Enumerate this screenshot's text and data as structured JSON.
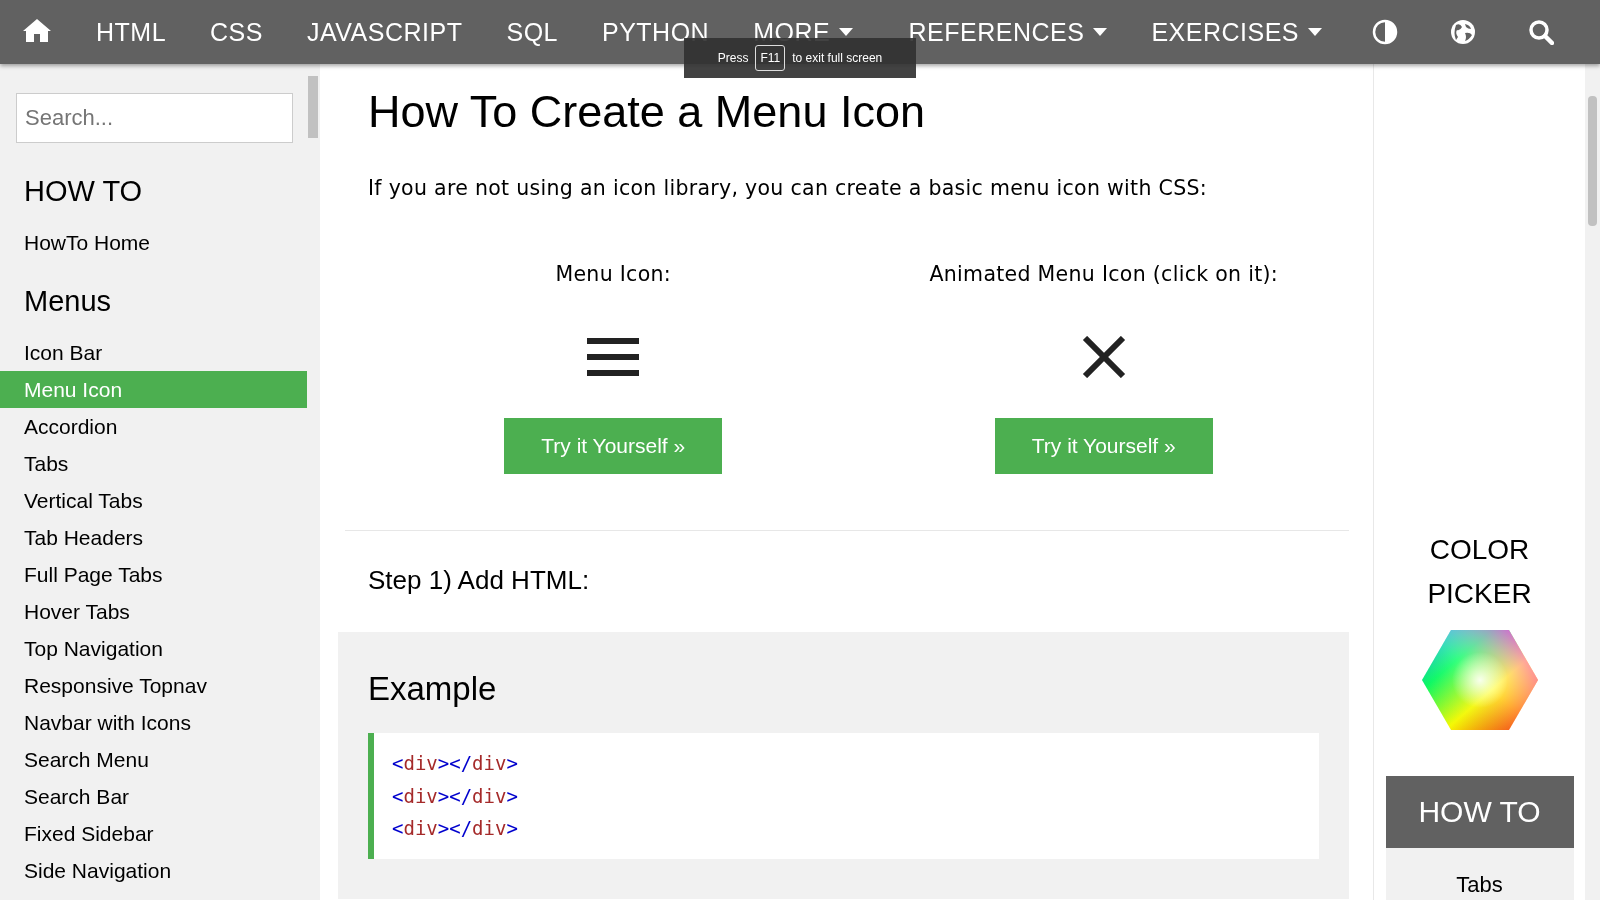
{
  "topnav": {
    "items": [
      {
        "label": "HTML",
        "dropdown": false
      },
      {
        "label": "CSS",
        "dropdown": false
      },
      {
        "label": "JAVASCRIPT",
        "dropdown": false
      },
      {
        "label": "SQL",
        "dropdown": false
      },
      {
        "label": "PYTHON",
        "dropdown": false
      },
      {
        "label": "MORE",
        "dropdown": true
      }
    ],
    "right_items": [
      {
        "label": "REFERENCES",
        "dropdown": true
      },
      {
        "label": "EXERCISES",
        "dropdown": true
      }
    ]
  },
  "fullscreen_notice": {
    "before": "Press",
    "key": "F11",
    "after": "to exit full screen"
  },
  "sidebar": {
    "search": {
      "placeholder": "Search..."
    },
    "sections": [
      {
        "heading": "HOW TO",
        "items": [
          {
            "label": "HowTo Home",
            "selected": false
          }
        ]
      },
      {
        "heading": "Menus",
        "items": [
          {
            "label": "Icon Bar",
            "selected": false
          },
          {
            "label": "Menu Icon",
            "selected": true
          },
          {
            "label": "Accordion",
            "selected": false
          },
          {
            "label": "Tabs",
            "selected": false
          },
          {
            "label": "Vertical Tabs",
            "selected": false
          },
          {
            "label": "Tab Headers",
            "selected": false
          },
          {
            "label": "Full Page Tabs",
            "selected": false
          },
          {
            "label": "Hover Tabs",
            "selected": false
          },
          {
            "label": "Top Navigation",
            "selected": false
          },
          {
            "label": "Responsive Topnav",
            "selected": false
          },
          {
            "label": "Navbar with Icons",
            "selected": false
          },
          {
            "label": "Search Menu",
            "selected": false
          },
          {
            "label": "Search Bar",
            "selected": false
          },
          {
            "label": "Fixed Sidebar",
            "selected": false
          },
          {
            "label": "Side Navigation",
            "selected": false
          }
        ]
      }
    ]
  },
  "main": {
    "title": "How To Create a Menu Icon",
    "intro": "If you are not using an icon library, you can create a basic menu icon with CSS:",
    "demos": [
      {
        "label": "Menu Icon:",
        "kind": "bars",
        "button": "Try it Yourself »"
      },
      {
        "label": "Animated Menu Icon (click on it):",
        "kind": "cross",
        "button": "Try it Yourself »"
      }
    ],
    "step": "Step 1) Add HTML:",
    "example": {
      "heading": "Example",
      "lines": [
        [
          {
            "kind": "bracket",
            "text": "<"
          },
          {
            "kind": "tag",
            "text": "div"
          },
          {
            "kind": "bracket",
            "text": "></"
          },
          {
            "kind": "tag",
            "text": "div"
          },
          {
            "kind": "bracket",
            "text": ">"
          }
        ],
        [
          {
            "kind": "bracket",
            "text": "<"
          },
          {
            "kind": "tag",
            "text": "div"
          },
          {
            "kind": "bracket",
            "text": "></"
          },
          {
            "kind": "tag",
            "text": "div"
          },
          {
            "kind": "bracket",
            "text": ">"
          }
        ],
        [
          {
            "kind": "bracket",
            "text": "<"
          },
          {
            "kind": "tag",
            "text": "div"
          },
          {
            "kind": "bracket",
            "text": "></"
          },
          {
            "kind": "tag",
            "text": "div"
          },
          {
            "kind": "bracket",
            "text": ">"
          }
        ]
      ]
    }
  },
  "right": {
    "color_picker": [
      "COLOR",
      "PICKER"
    ],
    "howto": {
      "heading": "HOW TO",
      "items": [
        "Tabs"
      ]
    }
  }
}
